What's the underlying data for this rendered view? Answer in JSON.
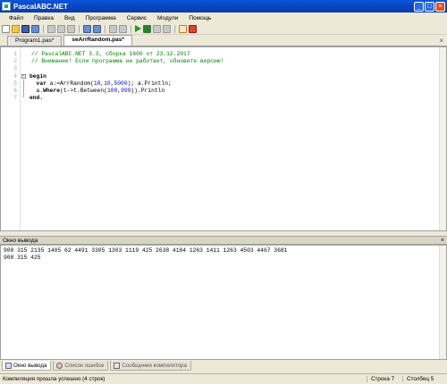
{
  "window": {
    "title": "PascalABC.NET"
  },
  "menu": [
    "Файл",
    "Правка",
    "Вид",
    "Программа",
    "Сервис",
    "Модули",
    "Помощь"
  ],
  "tabs": [
    {
      "label": "Program1.pas*"
    },
    {
      "label": "seArrRandom.pas*"
    }
  ],
  "editor": {
    "lines": [
      {
        "n": "1",
        "text": "// PascalABC.NET 3.3, сборка 1600 от 23.12.2017"
      },
      {
        "n": "2",
        "text": "// Внимание! Если программа не работает, обновите версию!"
      },
      {
        "n": "3",
        "text": ""
      },
      {
        "n": "4",
        "text": "begin"
      },
      {
        "n": "5",
        "text": "  var a:=ArrRandom(18,10,5000); a.Println;"
      },
      {
        "n": "6",
        "text": "  a.Where(t->t.Between(100,999)).Println"
      },
      {
        "n": "7",
        "text": "end."
      }
    ],
    "segments": {
      "l5a": "  var",
      "l5b": " a:=ArrRandom(",
      "l5c": "18",
      "l5d": ",",
      "l5e": "10",
      "l5f": ",",
      "l5g": "5000",
      "l5h": "); a.Println;",
      "l6a": "  a.",
      "l6b": "Where",
      "l6c": "(t->t.Between(",
      "l6d": "100",
      "l6e": ",",
      "l6f": "999",
      "l6g": ")).Println"
    }
  },
  "output": {
    "title": "Окно вывода",
    "lines": [
      "908 315 2135 1405 62 4491 3305 1303 1119 425 2638 4184 1263 1411 1263 4503 4467 3681",
      "908 315 425"
    ]
  },
  "bottom_tabs": [
    "Окно вывода",
    "Список ошибок",
    "Сообщения компилятора"
  ],
  "status": {
    "message": "Компиляция прошла успешно (4 строк)",
    "line": "Строка  7",
    "col": "Столбец  5"
  }
}
